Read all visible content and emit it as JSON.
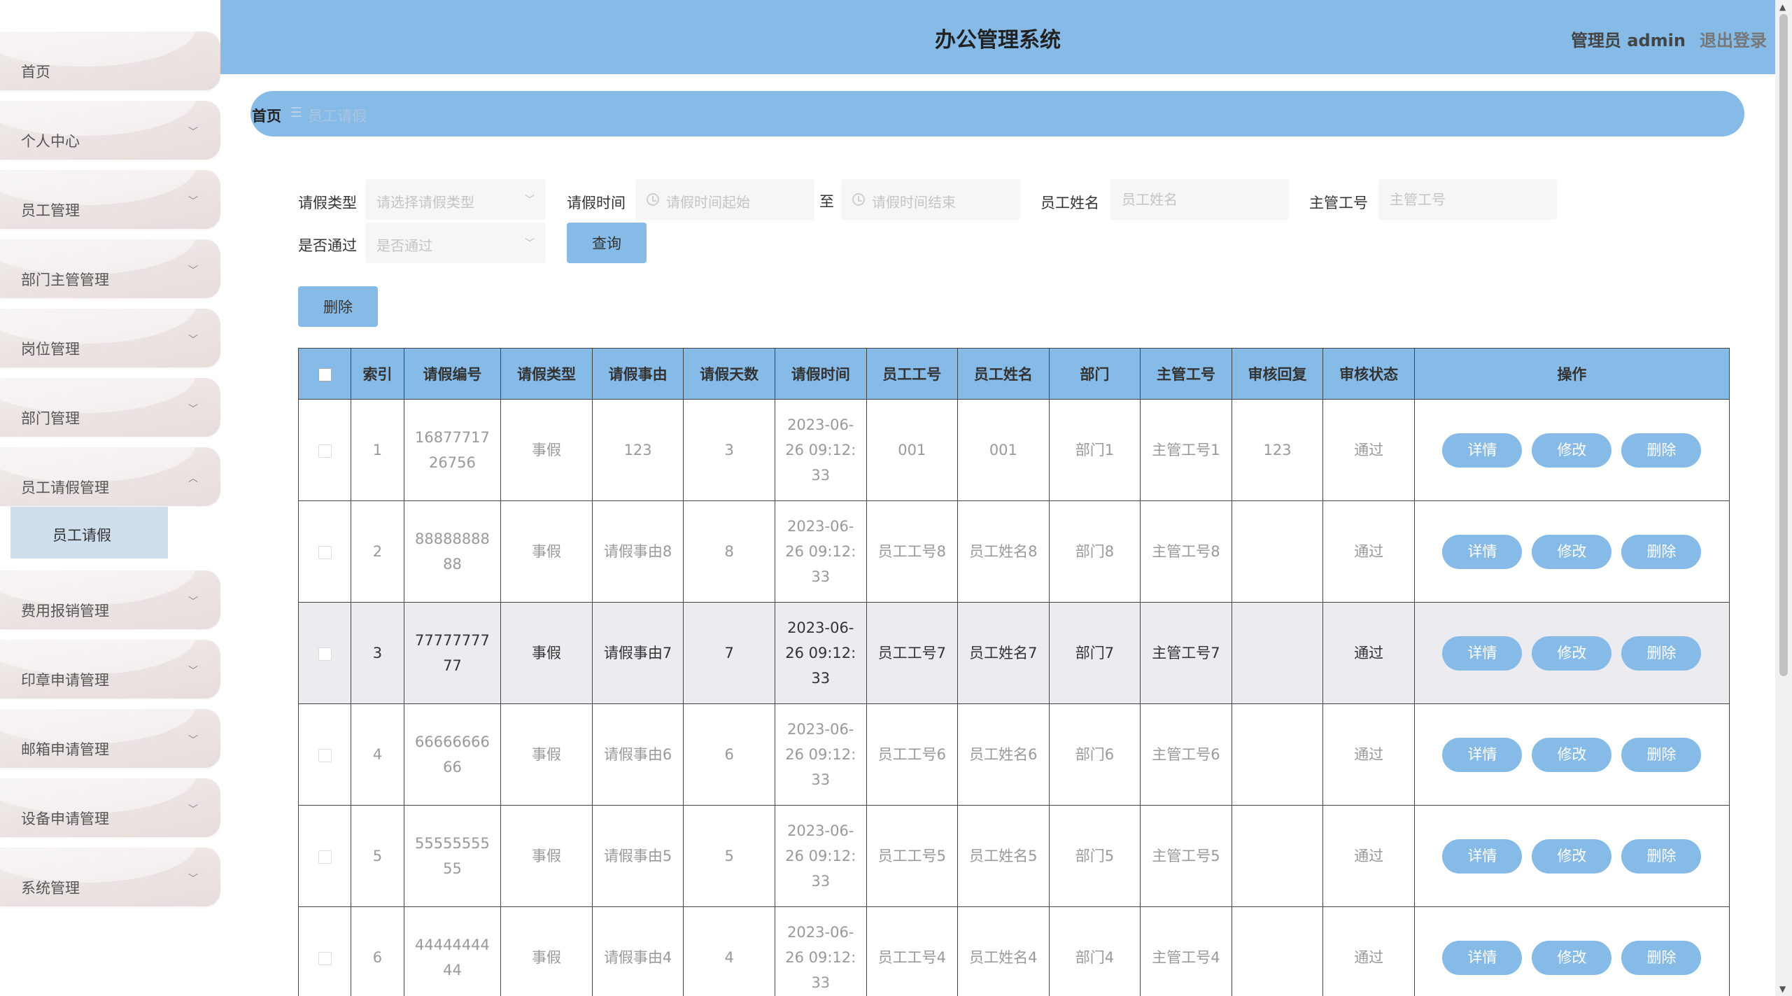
{
  "header": {
    "title": "办公管理系统",
    "user": "管理员 admin",
    "logout": "退出登录"
  },
  "sidebar": {
    "items": [
      {
        "label": "首页",
        "arrow": ""
      },
      {
        "label": "个人中心",
        "arrow": "﹀"
      },
      {
        "label": "员工管理",
        "arrow": "﹀"
      },
      {
        "label": "部门主管管理",
        "arrow": "﹀"
      },
      {
        "label": "岗位管理",
        "arrow": "﹀"
      },
      {
        "label": "部门管理",
        "arrow": "﹀"
      },
      {
        "label": "员工请假管理",
        "arrow": "︿"
      },
      {
        "label": "费用报销管理",
        "arrow": "﹀"
      },
      {
        "label": "印章申请管理",
        "arrow": "﹀"
      },
      {
        "label": "邮箱申请管理",
        "arrow": "﹀"
      },
      {
        "label": "设备申请管理",
        "arrow": "﹀"
      },
      {
        "label": "系统管理",
        "arrow": "﹀"
      }
    ],
    "submenu": {
      "label": "员工请假"
    }
  },
  "breadcrumb": {
    "home": "首页",
    "separator": "☰",
    "current": "员工请假"
  },
  "search": {
    "leave_type_label": "请假类型",
    "leave_type_placeholder": "请选择请假类型",
    "leave_time_label": "请假时间",
    "start_placeholder": "请假时间起始",
    "to": "至",
    "end_placeholder": "请假时间结束",
    "emp_name_label": "员工姓名",
    "emp_name_placeholder": "员工姓名",
    "manager_no_label": "主管工号",
    "manager_no_placeholder": "主管工号",
    "approved_label": "是否通过",
    "approved_placeholder": "是否通过",
    "query_button": "查询"
  },
  "delete_button": "删除",
  "table": {
    "columns": [
      "索引",
      "请假编号",
      "请假类型",
      "请假事由",
      "请假天数",
      "请假时间",
      "员工工号",
      "员工姓名",
      "部门",
      "主管工号",
      "审核回复",
      "审核状态",
      "操作"
    ],
    "rows": [
      {
        "index": "1",
        "no": "1687771726756",
        "type": "事假",
        "reason": "123",
        "days": "3",
        "time": "2023-06-26 09:12:33",
        "emp_no": "001",
        "emp_name": "001",
        "dept": "部门1",
        "manager_no": "主管工号1",
        "reply": "123",
        "status": "通过",
        "highlight": false
      },
      {
        "index": "2",
        "no": "8888888888",
        "type": "事假",
        "reason": "请假事由8",
        "days": "8",
        "time": "2023-06-26 09:12:33",
        "emp_no": "员工工号8",
        "emp_name": "员工姓名8",
        "dept": "部门8",
        "manager_no": "主管工号8",
        "reply": "",
        "status": "通过",
        "highlight": false
      },
      {
        "index": "3",
        "no": "7777777777",
        "type": "事假",
        "reason": "请假事由7",
        "days": "7",
        "time": "2023-06-26 09:12:33",
        "emp_no": "员工工号7",
        "emp_name": "员工姓名7",
        "dept": "部门7",
        "manager_no": "主管工号7",
        "reply": "",
        "status": "通过",
        "highlight": true
      },
      {
        "index": "4",
        "no": "6666666666",
        "type": "事假",
        "reason": "请假事由6",
        "days": "6",
        "time": "2023-06-26 09:12:33",
        "emp_no": "员工工号6",
        "emp_name": "员工姓名6",
        "dept": "部门6",
        "manager_no": "主管工号6",
        "reply": "",
        "status": "通过",
        "highlight": false
      },
      {
        "index": "5",
        "no": "5555555555",
        "type": "事假",
        "reason": "请假事由5",
        "days": "5",
        "time": "2023-06-26 09:12:33",
        "emp_no": "员工工号5",
        "emp_name": "员工姓名5",
        "dept": "部门5",
        "manager_no": "主管工号5",
        "reply": "",
        "status": "通过",
        "highlight": false
      },
      {
        "index": "6",
        "no": "4444444444",
        "type": "事假",
        "reason": "请假事由4",
        "days": "4",
        "time": "2023-06-26 09:12:33",
        "emp_no": "员工工号4",
        "emp_name": "员工姓名4",
        "dept": "部门4",
        "manager_no": "主管工号4",
        "reply": "",
        "status": "通过",
        "highlight": false
      }
    ],
    "actions": {
      "detail": "详情",
      "edit": "修改",
      "delete": "删除"
    }
  },
  "colors": {
    "accent": "#86bbe8",
    "submenu_active": "#cfdeed",
    "row_highlight": "#ececf0"
  }
}
